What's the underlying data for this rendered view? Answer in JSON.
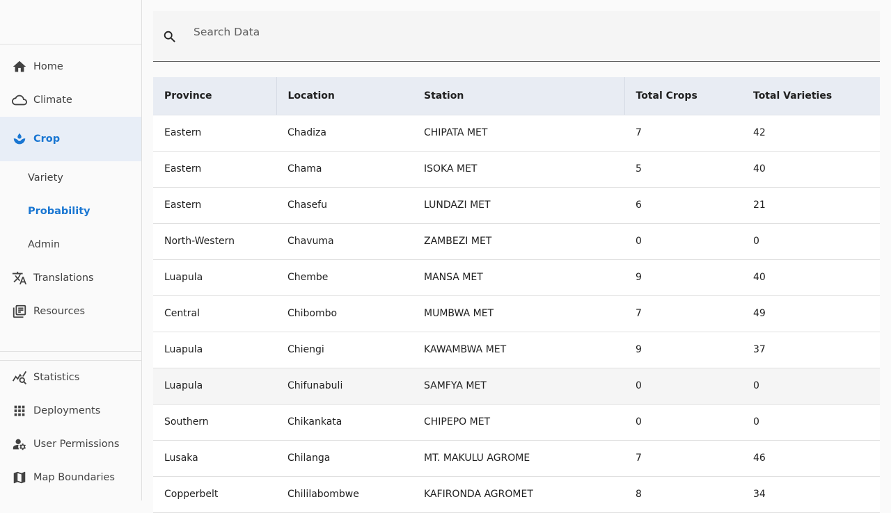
{
  "search": {
    "placeholder": "Search Data",
    "value": ""
  },
  "sidebar": {
    "items": [
      {
        "label": "Home",
        "icon": "home-icon"
      },
      {
        "label": "Climate",
        "icon": "cloud-icon"
      },
      {
        "label": "Crop",
        "icon": "crop-drop-icon"
      }
    ],
    "sub_items": [
      {
        "label": "Variety"
      },
      {
        "label": "Probability"
      },
      {
        "label": "Admin"
      }
    ],
    "items_after": [
      {
        "label": "Translations",
        "icon": "translate-icon"
      },
      {
        "label": "Resources",
        "icon": "library-books-icon"
      }
    ],
    "bottom_items": [
      {
        "label": "Statistics",
        "icon": "query-stats-icon"
      },
      {
        "label": "Deployments",
        "icon": "apps-grid-icon"
      },
      {
        "label": "User Permissions",
        "icon": "manage-accounts-icon"
      },
      {
        "label": "Map Boundaries",
        "icon": "map-icon"
      }
    ]
  },
  "table": {
    "columns": [
      "Province",
      "Location",
      "Station",
      "Total Crops",
      "Total Varieties"
    ],
    "rows": [
      [
        "Eastern",
        "Chadiza",
        "CHIPATA MET",
        "7",
        "42"
      ],
      [
        "Eastern",
        "Chama",
        "ISOKA MET",
        "5",
        "40"
      ],
      [
        "Eastern",
        "Chasefu",
        "LUNDAZI MET",
        "6",
        "21"
      ],
      [
        "North-Western",
        "Chavuma",
        "ZAMBEZI MET",
        "0",
        "0"
      ],
      [
        "Luapula",
        "Chembe",
        "MANSA MET",
        "9",
        "40"
      ],
      [
        "Central",
        "Chibombo",
        "MUMBWA MET",
        "7",
        "49"
      ],
      [
        "Luapula",
        "Chiengi",
        "KAWAMBWA MET",
        "9",
        "37"
      ],
      [
        "Luapula",
        "Chifunabuli",
        "SAMFYA MET",
        "0",
        "0"
      ],
      [
        "Southern",
        "Chikankata",
        "CHIPEPO MET",
        "0",
        "0"
      ],
      [
        "Lusaka",
        "Chilanga",
        "MT. MAKULU AGROME",
        "7",
        "46"
      ],
      [
        "Copperbelt",
        "Chililabombwe",
        "KAFIRONDA AGROMET",
        "8",
        "34"
      ]
    ]
  },
  "colors": {
    "accent": "#1976d2",
    "active_bg": "#e8eef7",
    "header_bg": "#e8ecf3"
  }
}
